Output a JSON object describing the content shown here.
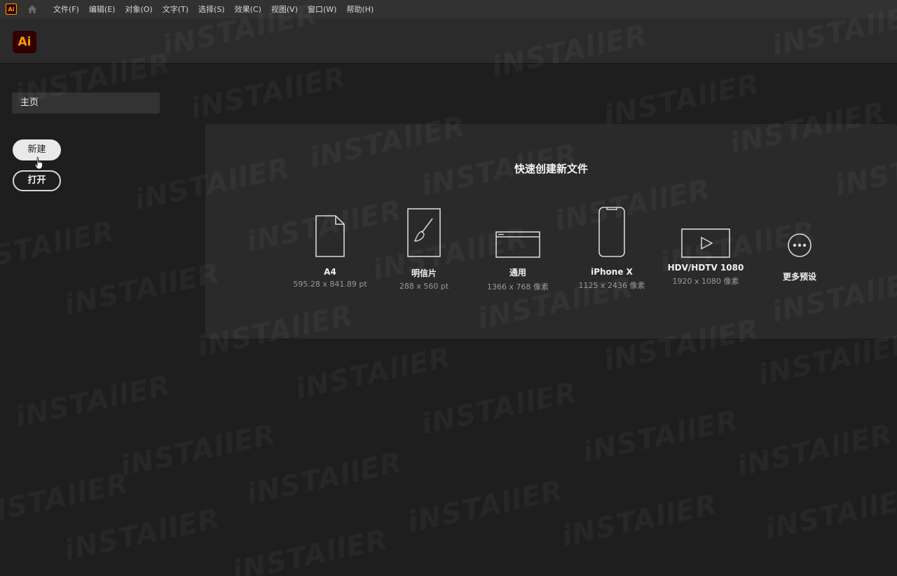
{
  "menubar": {
    "app_icon": "Ai",
    "home_icon": "home-icon",
    "items": [
      "文件(F)",
      "编辑(E)",
      "对象(O)",
      "文字(T)",
      "选择(S)",
      "效果(C)",
      "视图(V)",
      "窗口(W)",
      "帮助(H)"
    ]
  },
  "header": {
    "logo": "Ai"
  },
  "sidebar": {
    "home_label": "主页",
    "new_label": "新建",
    "open_label": "打开"
  },
  "quick_create": {
    "title": "快速创建新文件",
    "templates": [
      {
        "name": "A4",
        "size": "595.28 x 841.89 pt",
        "icon": "document-icon"
      },
      {
        "name": "明信片",
        "size": "288 x 560 pt",
        "icon": "postcard-brush-icon"
      },
      {
        "name": "通用",
        "size": "1366 x 768 像素",
        "icon": "browser-window-icon"
      },
      {
        "name": "iPhone X",
        "size": "1125 x 2436 像素",
        "icon": "phone-icon"
      },
      {
        "name": "HDV/HDTV 1080",
        "size": "1920 x 1080 像素",
        "icon": "video-play-icon"
      },
      {
        "name": "更多预设",
        "size": "",
        "icon": "more-dots-icon"
      }
    ]
  },
  "watermark": "iNSTAllER",
  "colors": {
    "accent": "#ff9a00",
    "logo_bg": "#330000",
    "background": "#1e1e1e"
  }
}
